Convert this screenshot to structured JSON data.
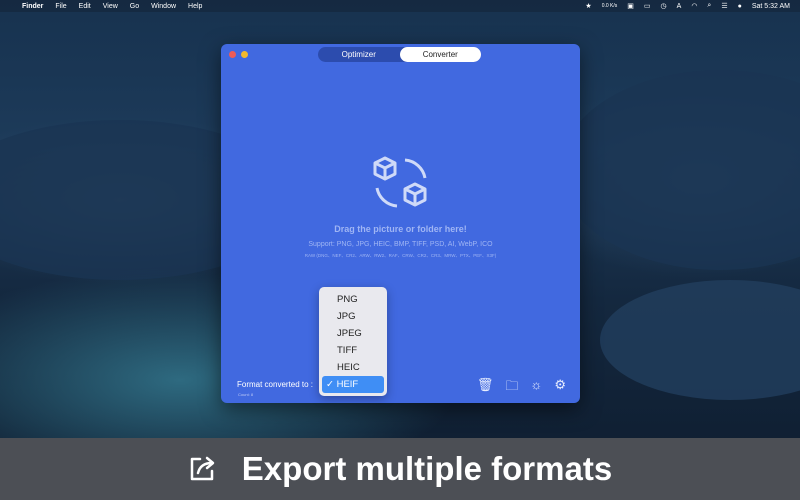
{
  "menubar": {
    "apple": "",
    "app": "Finder",
    "items": [
      "File",
      "Edit",
      "View",
      "Go",
      "Window",
      "Help"
    ],
    "net": "0.0 K/s",
    "clock": "Sat 5:32 AM"
  },
  "window": {
    "tabs": [
      {
        "label": "Optimizer",
        "active": false
      },
      {
        "label": "Converter",
        "active": true
      }
    ],
    "drop_title": "Drag the picture or folder here!",
    "support": "Support: PNG, JPG, HEIC, BMP, TIFF, PSD, AI, WebP, ICO",
    "raw": "RAW (DNG、NEF、CR2、ARW、RW2、RAF、CRW、CR2、CR3、MRW、PTX、PEF、X3F)",
    "format_label": "Format converted to :",
    "count": "Count: 8",
    "format_options": [
      "PNG",
      "JPG",
      "JPEG",
      "TIFF",
      "HEIC"
    ],
    "selected_format": "✓ HEIF",
    "tools": [
      "trash-icon",
      "folder-icon",
      "lightbulb-icon",
      "gear-icon"
    ]
  },
  "banner": {
    "text": "Export multiple formats",
    "icon": "share-export-icon"
  },
  "colors": {
    "window": "#4169e0",
    "selection": "#3f8ef5"
  }
}
